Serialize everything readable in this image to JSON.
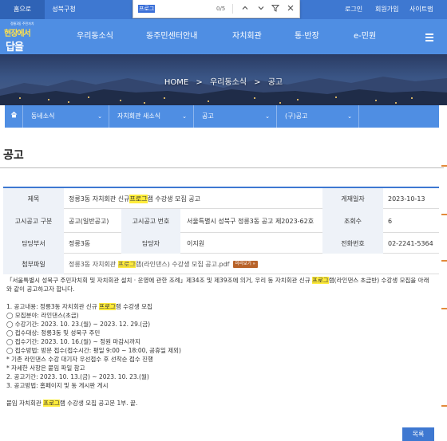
{
  "topbar": {
    "home": "홈으로",
    "district": "성북구청",
    "login": "로그인",
    "join": "회원가입",
    "sitemap": "사이트맵"
  },
  "findbar": {
    "query": "프로그",
    "count": "0/5",
    "icons": [
      "chevron-up-icon",
      "chevron-down-icon",
      "filter-icon",
      "close-icon"
    ]
  },
  "logo": {
    "small": "정릉3동 주민자치",
    "line1": "현장에서",
    "line2": "답을"
  },
  "gnb": [
    "우리동소식",
    "동주민센터안내",
    "자치회관",
    "통·반장",
    "e-민원"
  ],
  "hero": {
    "crumbs": [
      "HOME",
      "우리동소식",
      "공고"
    ],
    "separator": ">"
  },
  "subnav": [
    "동네소식",
    "자치회관 새소식",
    "공고",
    "(구)공고"
  ],
  "page_title": "공고",
  "table": {
    "title_label": "제목",
    "title_pre": "정릉3동 자치회관 신규 ",
    "title_hl": "프로그",
    "title_post": "램 수강생 모집 공고",
    "date_label": "게재일자",
    "date": "2023-10-13",
    "type_label": "고시공고 구분",
    "type": "공고(일반공고)",
    "no_label": "고시공고 번호",
    "no": "서울특별시 성북구 정릉3동 공고 제2023-62호",
    "views_label": "조회수",
    "views": "6",
    "dept_label": "담당부서",
    "dept": "정릉3동",
    "person_label": "담당자",
    "person": "이지원",
    "tel_label": "전화번호",
    "tel": "02-2241-5364",
    "attach_label": "첨부파일",
    "attach_pre": "정릉3동 자치회관 ",
    "attach_hl": "프로그",
    "attach_post": "램(라인댄스) 수강생 모집 공고.pdf",
    "attach_btn": "미리보기"
  },
  "content": {
    "intro_pre": "「서울특별시 성북구 주민자치회 및 자치회관 설치 · 운영에 관한 조례」제34조 및 제39조에 의거, 우리 동 자치회관 신규 ",
    "intro_hl": "프로그",
    "intro_post": "램(라인댄스 초급반) 수강생 모집을 아래",
    "intro2": "와 같이 공고하고자 합니다.",
    "l1_pre": "1. 공고내용: 정릉3동 자치회관 신규 ",
    "l1_hl": "프로그",
    "l1_post": "램 수강생 모집",
    "l2": "◯ 모집분야: 라인댄스(초급)",
    "l3": "◯ 수강기간: 2023. 10. 23.(월) ~ 2023. 12. 29.(금)",
    "l4": "◯ 접수대상: 정릉3동 및 성북구 주민",
    "l5": "◯ 접수기간: 2023. 10. 16.(월) ~ 정원 마감시까지",
    "l6": "◯ 접수방법: 방문 접수(접수시간: 평일 9:00 ~ 18:00, 공휴일 제외)",
    "l7": "* 기존 라인댄스 수강 대기자 우선접수 후 선착순 접수 진행",
    "l8": "* 자세한 사항은 붙임 파일 참고",
    "l9": "2. 공고기간: 2023. 10. 13.(금) ~ 2023. 10. 23.(월)",
    "l10": "3. 공고방법: 홈페이지 및 동 게시판 게시",
    "end_pre": "붙임 자치회관 ",
    "end_hl": "프로그",
    "end_post": "램 수강생 모집 공고문 1부. 끝."
  },
  "list_button": "목록",
  "colors": {
    "primary": "#3e78d1",
    "header": "#4f8ee3",
    "highlight": "#ffeb3b"
  }
}
